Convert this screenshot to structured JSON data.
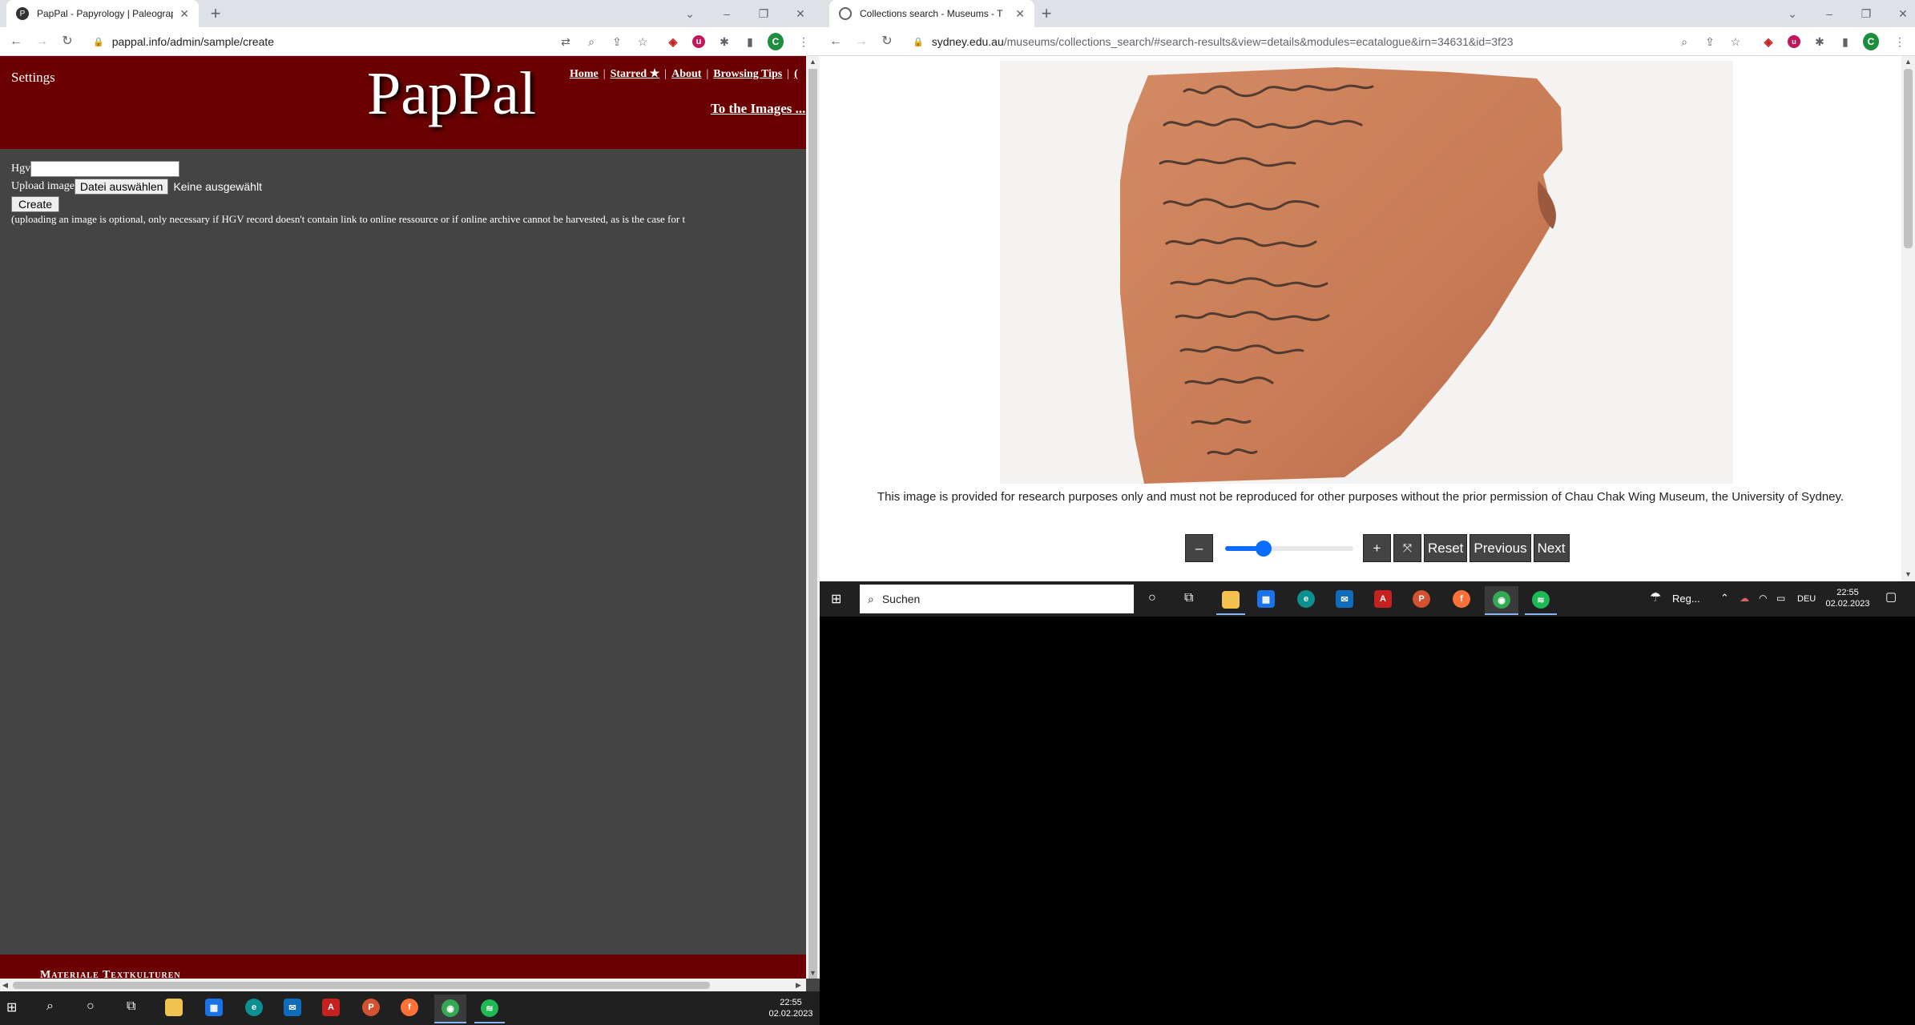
{
  "left_browser": {
    "tab_title": "PapPal - Papyrology | Paleograph",
    "url": "pappal.info/admin/sample/create",
    "page": {
      "settings_label": "Settings",
      "logo": "PapPal",
      "nav": [
        "Home",
        "Starred ★",
        "About",
        "Browsing Tips",
        "("
      ],
      "to_images_link": "To the Images ...",
      "hgv_label": "Hgv",
      "hgv_value": "",
      "upload_label": "Upload image",
      "file_button": "Datei auswählen",
      "no_file_text": "Keine ausgewählt",
      "create_button": "Create",
      "note": "(uploading an image is optional, only necessary if HGV record doesn't contain link to online ressource or if online archive cannot be harvested, as is the case for t",
      "footer_text": "Materiale Textkulturen"
    }
  },
  "right_browser": {
    "tab_title": "Collections search - Museums - T",
    "url_host": "sydney.edu.au",
    "url_path": "/museums/collections_search/#search-results&view=details&modules=ecatalogue&irn=34631&id=3f23",
    "caption": "This image is provided for research purposes only and must not be reproduced for other purposes without the prior permission of Chau Chak Wing Museum, the University of Sydney.",
    "controls": {
      "zoom_out": "–",
      "zoom_in": "+",
      "fit": "⤧",
      "reset": "Reset",
      "previous": "Previous",
      "next": "Next",
      "zoom_level": 0.3
    }
  },
  "taskbar_small": {
    "search_placeholder": "Suchen",
    "weather": "Reg...",
    "language": "DEU",
    "time": "22:55",
    "date": "02.02.2023"
  },
  "taskbar_main": {
    "time": "22:55",
    "date": "02.02.2023"
  },
  "colors": {
    "pappal_red": "#6b0000",
    "page_gray": "#444444",
    "accent_blue": "#0a6cff",
    "ostracon": "#c87a55"
  }
}
